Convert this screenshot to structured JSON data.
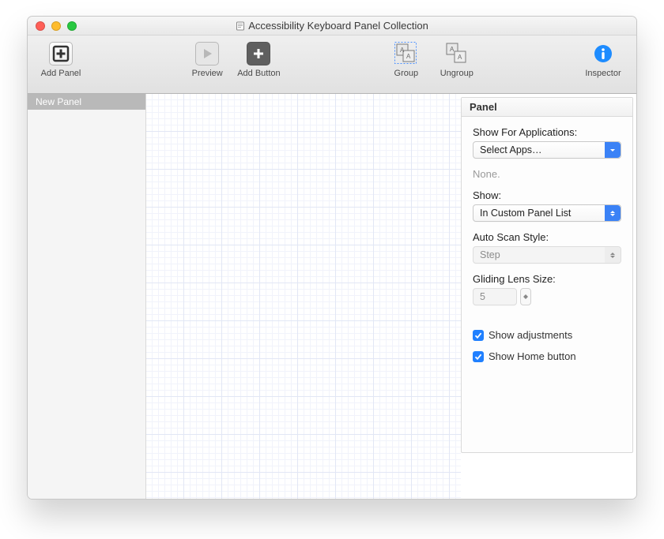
{
  "window_title": "Accessibility Keyboard Panel Collection",
  "toolbar": {
    "add_panel": "Add Panel",
    "preview": "Preview",
    "add_button": "Add Button",
    "group": "Group",
    "ungroup": "Ungroup",
    "inspector": "Inspector"
  },
  "sidebar": {
    "items": [
      {
        "label": "New Panel"
      }
    ]
  },
  "inspector": {
    "header": "Panel",
    "show_for_applications_label": "Show For Applications:",
    "select_apps_value": "Select Apps…",
    "none_text": "None.",
    "show_label": "Show:",
    "show_value": "In Custom Panel List",
    "auto_scan_label": "Auto Scan Style:",
    "auto_scan_value": "Step",
    "gliding_lens_label": "Gliding Lens Size:",
    "gliding_lens_value": "5",
    "show_adjustments": "Show adjustments",
    "show_home_button": "Show Home button"
  }
}
